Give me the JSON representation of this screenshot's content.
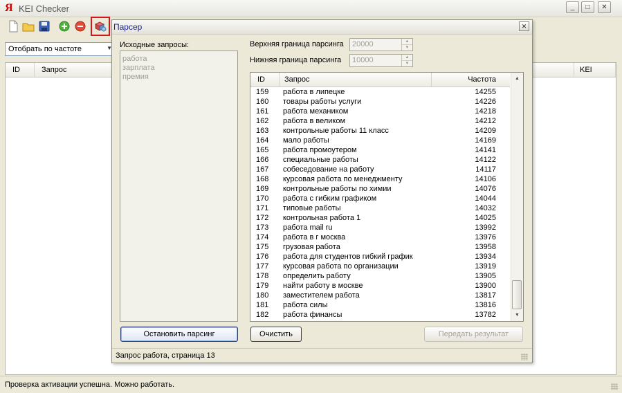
{
  "window": {
    "logo": "Я",
    "title": "KEI Checker",
    "controls": {
      "minimize": "_",
      "maximize": "□",
      "close": "✕"
    }
  },
  "toolbar": {
    "buttons": [
      {
        "name": "new-icon"
      },
      {
        "name": "open-folder-icon"
      },
      {
        "name": "save-icon"
      },
      {
        "name": "add-icon"
      },
      {
        "name": "remove-icon"
      },
      {
        "name": "parser-icon",
        "highlighted": true
      }
    ],
    "filter_combo": {
      "value": "Отобрать по частоте"
    }
  },
  "main_grid": {
    "columns": [
      "ID",
      "Запрос",
      "KEI"
    ]
  },
  "status": {
    "text": "Проверка активации успешна. Можно работать."
  },
  "dialog": {
    "title": "Парсер",
    "close": "✕",
    "source_label": "Исходные запросы:",
    "source_queries": [
      "работа",
      "зарплата",
      "премия"
    ],
    "upper_label": "Верхняя граница парсинга",
    "upper_value": "20000",
    "lower_label": "Нижняя граница парсинга",
    "lower_value": "10000",
    "results": {
      "columns": [
        "ID",
        "Запрос",
        "Частота"
      ],
      "rows": [
        [
          "159",
          "работа в липецке",
          "14255"
        ],
        [
          "160",
          "товары работы услуги",
          "14226"
        ],
        [
          "161",
          "работа механиком",
          "14218"
        ],
        [
          "162",
          "работа в великом",
          "14212"
        ],
        [
          "163",
          "контрольные работы 11 класс",
          "14209"
        ],
        [
          "164",
          "мало работы",
          "14169"
        ],
        [
          "165",
          "работа промоутером",
          "14141"
        ],
        [
          "166",
          "специальные работы",
          "14122"
        ],
        [
          "167",
          "собеседование на работу",
          "14117"
        ],
        [
          "168",
          "курсовая работа по менеджменту",
          "14106"
        ],
        [
          "169",
          "контрольные работы по химии",
          "14076"
        ],
        [
          "170",
          "работа с гибким графиком",
          "14044"
        ],
        [
          "171",
          "типовые работы",
          "14032"
        ],
        [
          "172",
          "контрольная работа 1",
          "14025"
        ],
        [
          "173",
          "работа mail ru",
          "13992"
        ],
        [
          "174",
          "работа в г москва",
          "13976"
        ],
        [
          "175",
          "грузовая работа",
          "13958"
        ],
        [
          "176",
          "работа для студентов гибкий график",
          "13934"
        ],
        [
          "177",
          "курсовая работа по организации",
          "13919"
        ],
        [
          "178",
          "определить работу",
          "13905"
        ],
        [
          "179",
          "найти работу в москве",
          "13900"
        ],
        [
          "180",
          "заместителем работа",
          "13817"
        ],
        [
          "181",
          "работа силы",
          "13816"
        ],
        [
          "182",
          "работа финансы",
          "13782"
        ]
      ]
    },
    "buttons": {
      "stop": "Остановить парсинг",
      "clear": "Очистить",
      "send": "Передать результат"
    },
    "status": "Запрос работа, страница 13"
  }
}
